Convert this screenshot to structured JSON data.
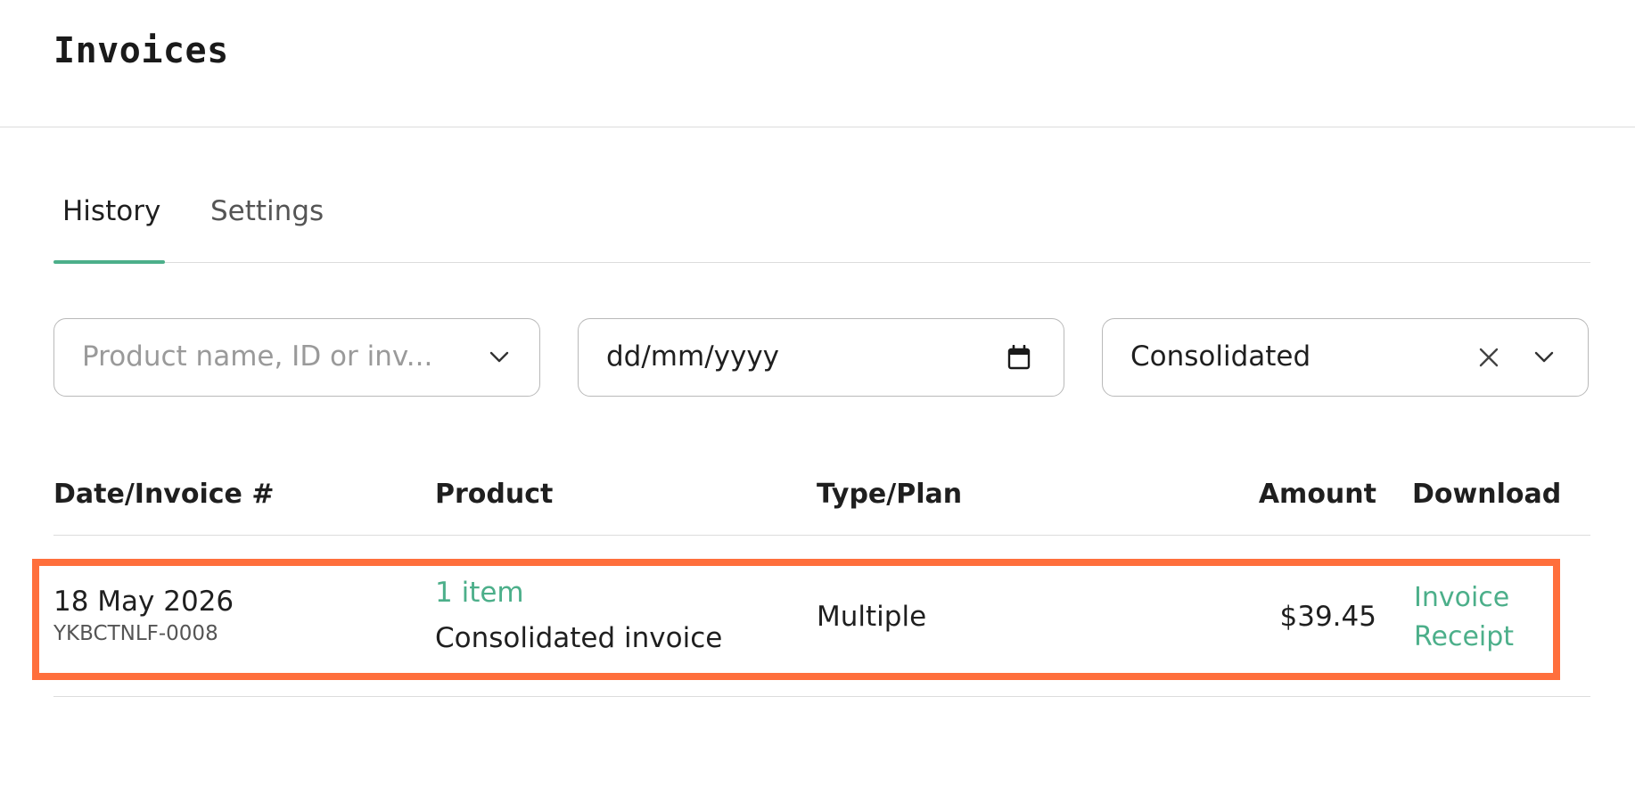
{
  "page": {
    "title": "Invoices"
  },
  "tabs": [
    {
      "label": "History",
      "active": true
    },
    {
      "label": "Settings",
      "active": false
    }
  ],
  "filters": {
    "product": {
      "placeholder": "Product name, ID or inv...",
      "icon": "chevron-down-icon"
    },
    "date": {
      "value": "dd/mm/yyyy",
      "icon": "calendar-icon"
    },
    "type": {
      "value": "Consolidated",
      "clear_icon": "close-icon",
      "icon": "chevron-down-icon"
    }
  },
  "table": {
    "headers": {
      "date": "Date/Invoice #",
      "product": "Product",
      "type": "Type/Plan",
      "amount": "Amount",
      "download": "Download"
    },
    "rows": [
      {
        "date": "18 May 2026",
        "invoice_number": "YKBCTNLF-0008",
        "product_link": "1 item",
        "product_desc": "Consolidated invoice",
        "type": "Multiple",
        "amount": "$39.45",
        "download_invoice": "Invoice",
        "download_receipt": "Receipt"
      }
    ]
  },
  "colors": {
    "accent": "#4caf8a",
    "highlight": "#ff6f3c",
    "border": "#b9b9b9",
    "divider": "#dcdcdc"
  }
}
